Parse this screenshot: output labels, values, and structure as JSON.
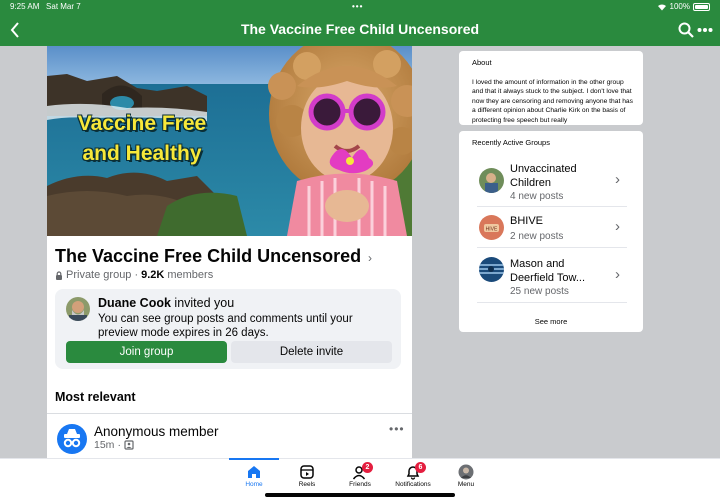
{
  "status_bar": {
    "time": "9:25 AM",
    "date": "Sat Mar 7",
    "dots": "•••",
    "battery": "100%"
  },
  "header": {
    "title": "The Vaccine Free Child Uncensored",
    "back_icon": "chevron-left-icon",
    "search_icon": "search-icon",
    "more_icon": "more-icon"
  },
  "cover": {
    "line1": "Vaccine Free",
    "line2": "and Healthy"
  },
  "group": {
    "name": "The Vaccine Free Child Uncensored",
    "chevron": "›",
    "privacy": "Private group",
    "separator": "·",
    "member_count": "9.2K",
    "members_label": "members"
  },
  "invite": {
    "inviter": "Duane Cook",
    "action": "invited you",
    "message": "You can see group posts and comments until your preview mode expires in 26 days.",
    "join_label": "Join group",
    "delete_label": "Delete invite"
  },
  "feed": {
    "section_title": "Most relevant",
    "post": {
      "author": "Anonymous member",
      "time": "15m",
      "separator": "·",
      "more": "•••"
    }
  },
  "about": {
    "heading": "About",
    "text": "I loved the amount of information in the other group and that it always stuck to the subject. I don't love that now they are censoring and removing anyone that has a different opinion about Charlie Kirk on the basis of protecting free speech but really"
  },
  "recent_groups": {
    "heading": "Recently Active Groups",
    "items": [
      {
        "name": "Unvaccinated Children",
        "subtitle": "4 new posts"
      },
      {
        "name": "BHIVE",
        "subtitle": "2 new posts"
      },
      {
        "name": "Mason and Deerfield Tow...",
        "subtitle": "25 new posts"
      }
    ],
    "chevron": "›",
    "see_more": "See more"
  },
  "tabs": [
    {
      "label": "Home",
      "active": true
    },
    {
      "label": "Reels"
    },
    {
      "label": "Friends",
      "badge": "2"
    },
    {
      "label": "Notifications",
      "badge": "6"
    },
    {
      "label": "Menu"
    }
  ],
  "colors": {
    "brand_green": "#2a8a3e",
    "accent_blue": "#1877f2",
    "badge_red": "#e41e3f",
    "cover_text": "#f7e83a"
  }
}
